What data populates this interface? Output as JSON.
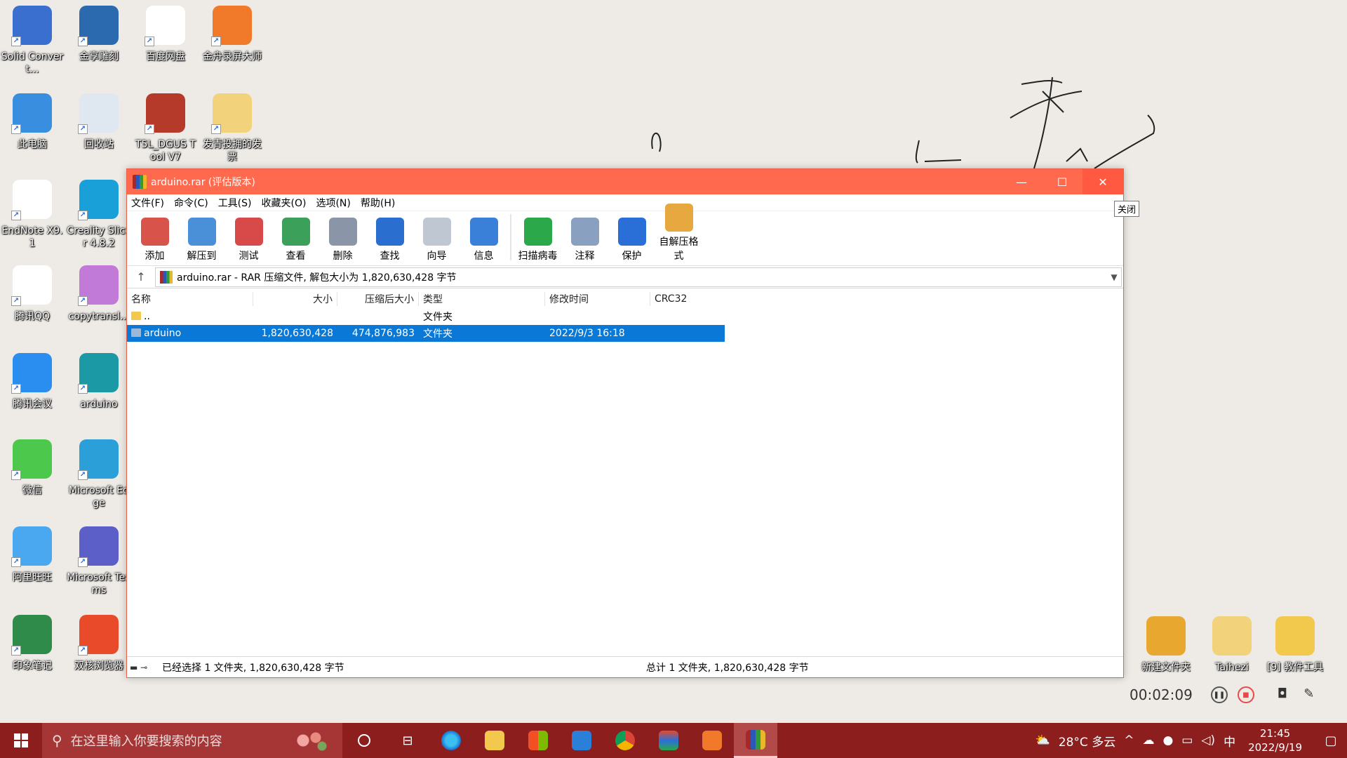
{
  "desktop": {
    "icons": [
      {
        "label": "Solid Convert...",
        "color": "#3a6fd0"
      },
      {
        "label": "金享雕刻",
        "color": "#2c6ab0"
      },
      {
        "label": "百度网盘",
        "color": "#ffffff"
      },
      {
        "label": "金舟录屏大师",
        "color": "#f07a2a"
      },
      {
        "label": "此电脑",
        "color": "#3a8ee0"
      },
      {
        "label": "回收站",
        "color": "#dfe8f0"
      },
      {
        "label": "T5L_DGUS Tool V7",
        "color": "#b53a2a"
      },
      {
        "label": "发青投拥的发票",
        "color": "#f2d27a"
      },
      {
        "label": "EndNote X9.1",
        "color": "#ffffff"
      },
      {
        "label": "Creality Slicer 4.8.2",
        "color": "#1aa0d8"
      },
      {
        "label": "腾讯QQ",
        "color": "#ffffff"
      },
      {
        "label": "copytransl...",
        "color": "#c27ad8"
      },
      {
        "label": "腾讯会议",
        "color": "#2a8df0"
      },
      {
        "label": "arduino",
        "color": "#1b9aa6"
      },
      {
        "label": "微信",
        "color": "#4cc84c"
      },
      {
        "label": "Microsoft Edge",
        "color": "#2a9fd8"
      },
      {
        "label": "阿里旺旺",
        "color": "#4aa8f0"
      },
      {
        "label": "Microsoft Teams",
        "color": "#5b5fc7"
      },
      {
        "label": "印象笔记",
        "color": "#2e8b4a"
      },
      {
        "label": "双核浏览器",
        "color": "#e84a2a"
      },
      {
        "label": "新建文件夹",
        "color": "#e8a830"
      },
      {
        "label": "Taihezi",
        "color": "#f2d27a"
      },
      {
        "label": "[9] 教件工具",
        "color": "#f2c94c"
      }
    ]
  },
  "window": {
    "title": "arduino.rar (评估版本)",
    "minimize": "—",
    "maximize": "☐",
    "close": "✕",
    "tooltip": "关闭",
    "menu": [
      "文件(F)",
      "命令(C)",
      "工具(S)",
      "收藏夹(O)",
      "选项(N)",
      "帮助(H)"
    ],
    "toolbar": [
      {
        "label": "添加",
        "color": "#d8534a"
      },
      {
        "label": "解压到",
        "color": "#4a90d8"
      },
      {
        "label": "测试",
        "color": "#d84a4a"
      },
      {
        "label": "查看",
        "color": "#3aa05a"
      },
      {
        "label": "删除",
        "color": "#8a96a8"
      },
      {
        "label": "查找",
        "color": "#2a6fd0"
      },
      {
        "label": "向导",
        "color": "#bfc7d2"
      },
      {
        "label": "信息",
        "color": "#3a7fd8"
      },
      {
        "label": "扫描病毒",
        "color": "#2aa84a"
      },
      {
        "label": "注释",
        "color": "#8aa0c0"
      },
      {
        "label": "保护",
        "color": "#2a6fd8"
      },
      {
        "label": "自解压格式",
        "color": "#e8a840"
      }
    ],
    "address": "arduino.rar - RAR 压缩文件, 解包大小为 1,820,630,428 字节",
    "columns": [
      "名称",
      "大小",
      "压缩后大小",
      "类型",
      "修改时间",
      "CRC32"
    ],
    "rows": [
      {
        "name": "..",
        "size": "",
        "packed": "",
        "type": "文件夹",
        "modified": "",
        "crc": ""
      },
      {
        "name": "arduino",
        "size": "1,820,630,428",
        "packed": "474,876,983",
        "type": "文件夹",
        "modified": "2022/9/3 16:18",
        "crc": ""
      }
    ],
    "status_left": "已经选择 1 文件夹, 1,820,630,428 字节",
    "status_right": "总计 1 文件夹, 1,820,630,428 字节"
  },
  "recorder": {
    "time": "00:02:09"
  },
  "taskbar": {
    "search_placeholder": "在这里输入你要搜索的内容",
    "weather": "28°C  多云",
    "ime": "中",
    "time": "21:45",
    "date": "2022/9/19"
  }
}
